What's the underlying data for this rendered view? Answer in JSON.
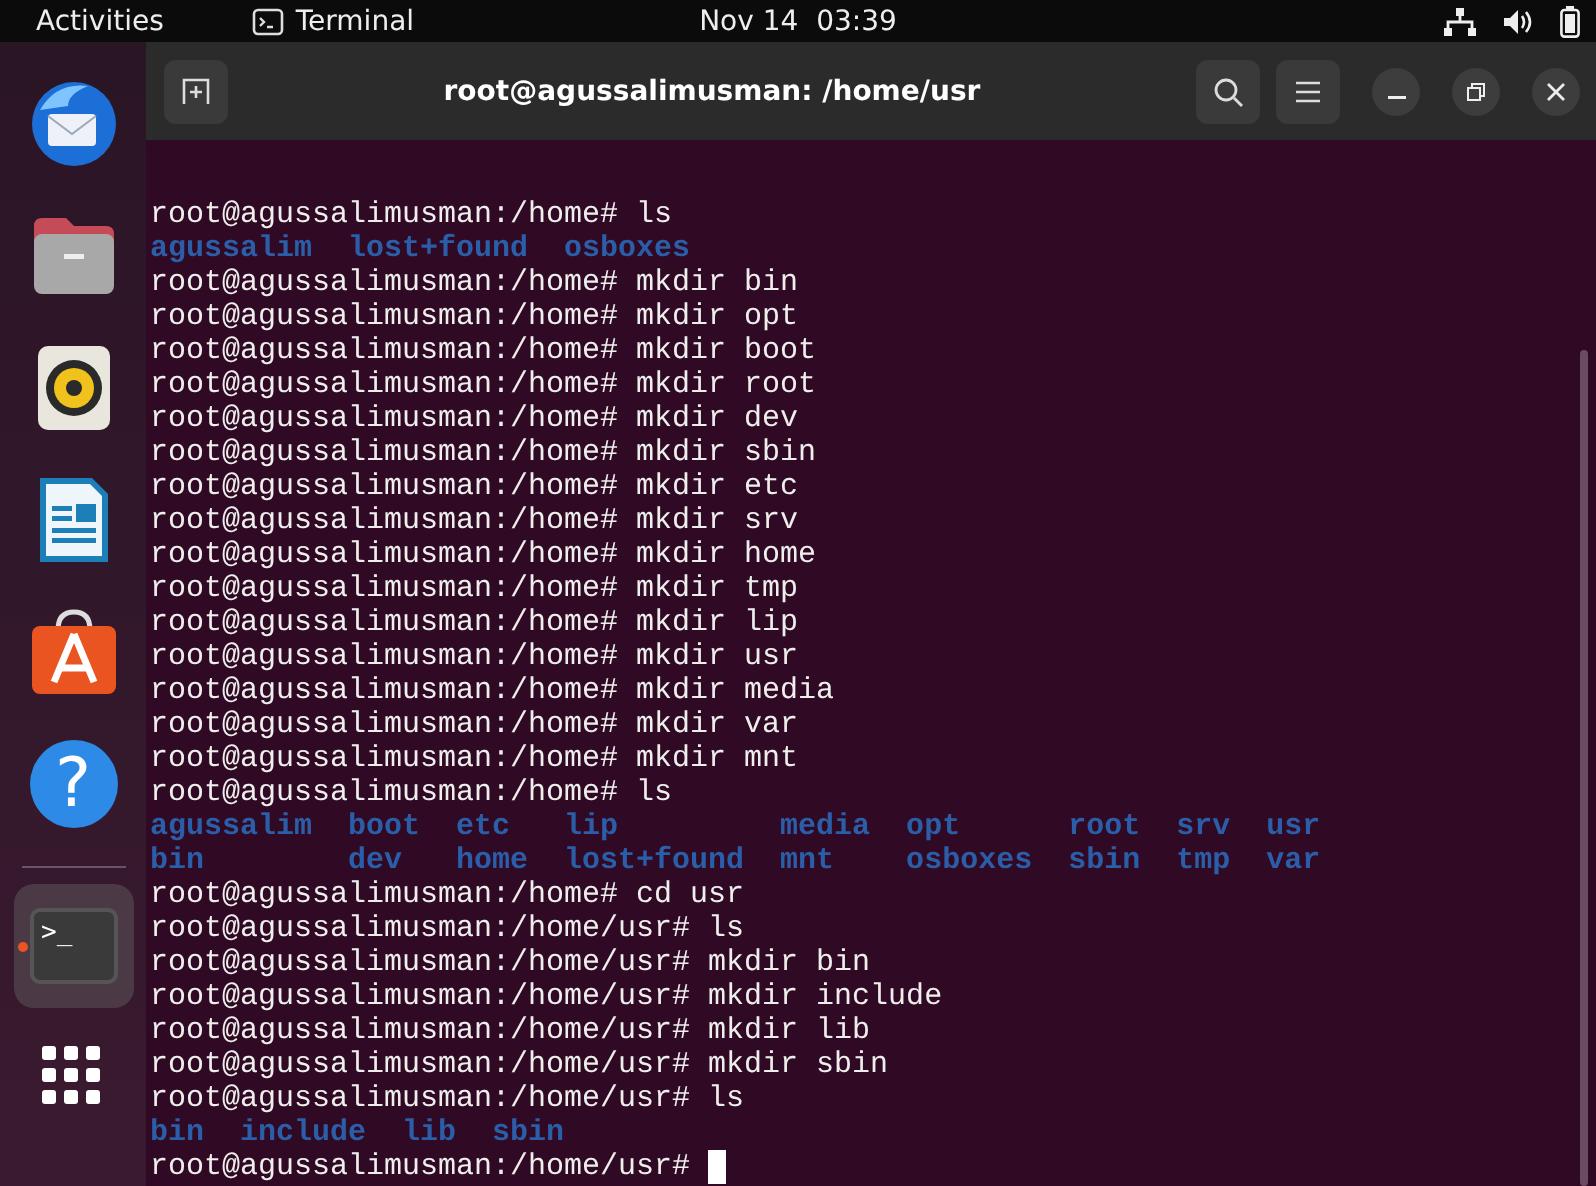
{
  "top_bar": {
    "activities": "Activities",
    "app_name": "Terminal",
    "clock": "Nov 14  03:39"
  },
  "dock": {
    "items": [
      {
        "kind": "mail",
        "running": false
      },
      {
        "kind": "files",
        "running": false
      },
      {
        "kind": "music",
        "running": false
      },
      {
        "kind": "writer",
        "running": false
      },
      {
        "kind": "store",
        "running": false
      },
      {
        "kind": "help",
        "glyph": "?",
        "running": false
      },
      {
        "kind": "separator"
      },
      {
        "kind": "terminal",
        "glyph": ">_",
        "running": true
      },
      {
        "kind": "apps",
        "running": false
      }
    ]
  },
  "window": {
    "title": "root@agussalimusman: /home/usr"
  },
  "terminal": {
    "lines": [
      {
        "kind": "prompt",
        "text": "root@agussalimusman:/home# ls"
      },
      {
        "kind": "output",
        "text": "agussalim  lost+found  osboxes"
      },
      {
        "kind": "prompt",
        "text": "root@agussalimusman:/home# mkdir bin"
      },
      {
        "kind": "prompt",
        "text": "root@agussalimusman:/home# mkdir opt"
      },
      {
        "kind": "prompt",
        "text": "root@agussalimusman:/home# mkdir boot"
      },
      {
        "kind": "prompt",
        "text": "root@agussalimusman:/home# mkdir root"
      },
      {
        "kind": "prompt",
        "text": "root@agussalimusman:/home# mkdir dev"
      },
      {
        "kind": "prompt",
        "text": "root@agussalimusman:/home# mkdir sbin"
      },
      {
        "kind": "prompt",
        "text": "root@agussalimusman:/home# mkdir etc"
      },
      {
        "kind": "prompt",
        "text": "root@agussalimusman:/home# mkdir srv"
      },
      {
        "kind": "prompt",
        "text": "root@agussalimusman:/home# mkdir home"
      },
      {
        "kind": "prompt",
        "text": "root@agussalimusman:/home# mkdir tmp"
      },
      {
        "kind": "prompt",
        "text": "root@agussalimusman:/home# mkdir lip"
      },
      {
        "kind": "prompt",
        "text": "root@agussalimusman:/home# mkdir usr"
      },
      {
        "kind": "prompt",
        "text": "root@agussalimusman:/home# mkdir media"
      },
      {
        "kind": "prompt",
        "text": "root@agussalimusman:/home# mkdir var"
      },
      {
        "kind": "prompt",
        "text": "root@agussalimusman:/home# mkdir mnt"
      },
      {
        "kind": "prompt",
        "text": "root@agussalimusman:/home# ls"
      },
      {
        "kind": "output",
        "text": "agussalim  boot  etc   lip         media  opt      root  srv  usr"
      },
      {
        "kind": "output",
        "text": "bin        dev   home  lost+found  mnt    osboxes  sbin  tmp  var"
      },
      {
        "kind": "prompt",
        "text": "root@agussalimusman:/home# cd usr"
      },
      {
        "kind": "prompt",
        "text": "root@agussalimusman:/home/usr# ls"
      },
      {
        "kind": "prompt",
        "text": "root@agussalimusman:/home/usr# mkdir bin"
      },
      {
        "kind": "prompt",
        "text": "root@agussalimusman:/home/usr# mkdir include"
      },
      {
        "kind": "prompt",
        "text": "root@agussalimusman:/home/usr# mkdir lib"
      },
      {
        "kind": "prompt",
        "text": "root@agussalimusman:/home/usr# mkdir sbin"
      },
      {
        "kind": "prompt",
        "text": "root@agussalimusman:/home/usr# ls"
      },
      {
        "kind": "output",
        "text": "bin  include  lib  sbin"
      },
      {
        "kind": "prompt",
        "text": "root@agussalimusman:/home/usr#",
        "cursor": true
      }
    ]
  }
}
